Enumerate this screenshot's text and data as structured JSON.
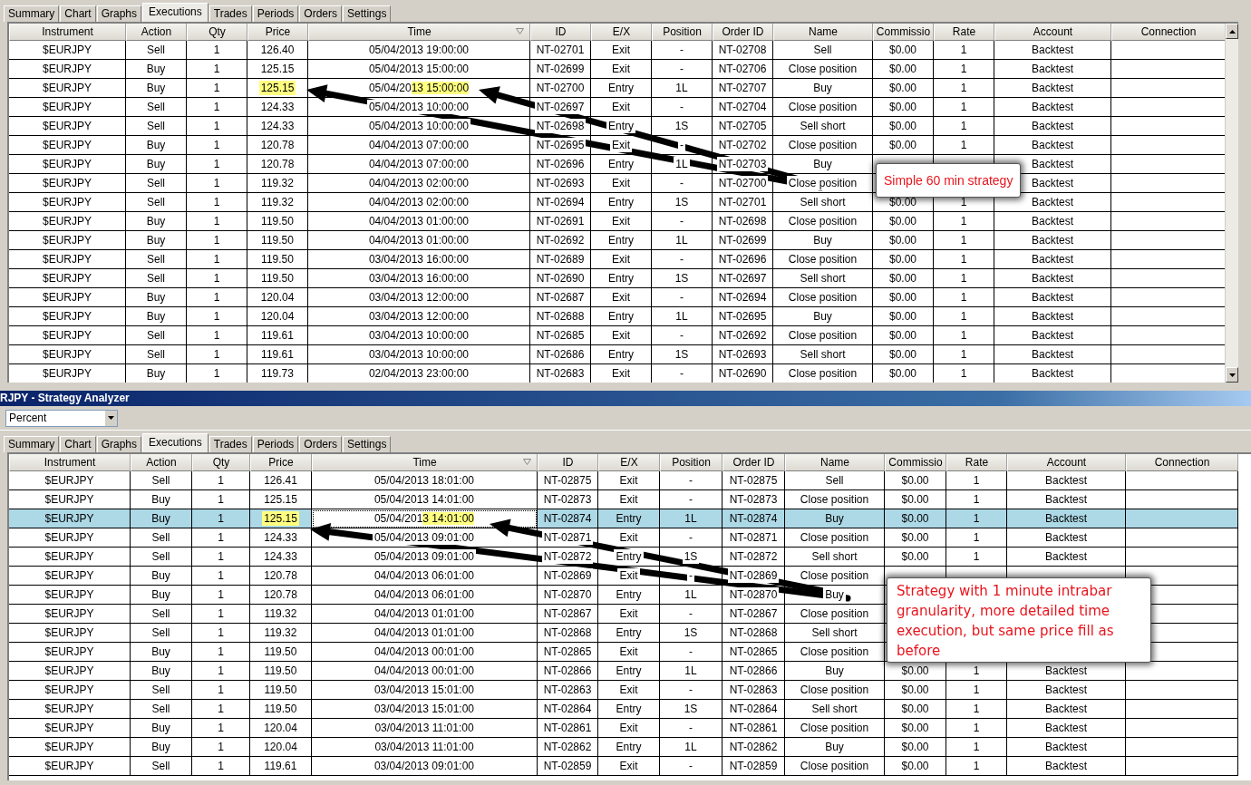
{
  "top_panel": {
    "tabs": [
      {
        "label": "Summary",
        "selected": false
      },
      {
        "label": "Chart",
        "selected": false
      },
      {
        "label": "Graphs",
        "selected": false
      },
      {
        "label": "Executions",
        "selected": true
      },
      {
        "label": "Trades",
        "selected": false
      },
      {
        "label": "Periods",
        "selected": false
      },
      {
        "label": "Orders",
        "selected": false
      },
      {
        "label": "Settings",
        "selected": false
      }
    ],
    "table": {
      "columns": [
        "Instrument",
        "Action",
        "Qty",
        "Price",
        "Time",
        "ID",
        "E/X",
        "Position",
        "Order ID",
        "Name",
        "Commissio",
        "Rate",
        "Account",
        "Connection"
      ],
      "rows": [
        {
          "instrument": "$EURJPY",
          "action": "Sell",
          "qty": "1",
          "price": "126.40",
          "time": "05/04/2013 19:00:00",
          "id": "NT-02701",
          "ex": "Exit",
          "position": "-",
          "order_id": "NT-02708",
          "name": "Sell",
          "commission": "$0.00",
          "rate": "1",
          "account": "Backtest",
          "highlighted": false
        },
        {
          "instrument": "$EURJPY",
          "action": "Buy",
          "qty": "1",
          "price": "125.15",
          "time": "05/04/2013 15:00:00",
          "id": "NT-02699",
          "ex": "Exit",
          "position": "-",
          "order_id": "NT-02706",
          "name": "Close position",
          "commission": "$0.00",
          "rate": "1",
          "account": "Backtest",
          "highlighted": false
        },
        {
          "instrument": "$EURJPY",
          "action": "Buy",
          "qty": "1",
          "price": "125.15",
          "time": "05/04/20",
          "time_marked": "13 15:00:00",
          "id": "NT-02700",
          "ex": "Entry",
          "position": "1L",
          "order_id": "NT-02707",
          "name": "Buy",
          "commission": "$0.00",
          "rate": "1",
          "account": "Backtest",
          "highlighted": true
        },
        {
          "instrument": "$EURJPY",
          "action": "Sell",
          "qty": "1",
          "price": "124.33",
          "time": "05/04/2013 10:00:00",
          "id": "NT-02697",
          "ex": "Exit",
          "position": "-",
          "order_id": "NT-02704",
          "name": "Close position",
          "commission": "$0.00",
          "rate": "1",
          "account": "Backtest",
          "highlighted": false
        },
        {
          "instrument": "$EURJPY",
          "action": "Sell",
          "qty": "1",
          "price": "124.33",
          "time": "05/04/2013 10:00:00",
          "id": "NT-02698",
          "ex": "Entry",
          "position": "1S",
          "order_id": "NT-02705",
          "name": "Sell short",
          "commission": "$0.00",
          "rate": "1",
          "account": "Backtest",
          "highlighted": false
        },
        {
          "instrument": "$EURJPY",
          "action": "Buy",
          "qty": "1",
          "price": "120.78",
          "time": "04/04/2013 07:00:00",
          "id": "NT-02695",
          "ex": "Exit",
          "position": "-",
          "order_id": "NT-02702",
          "name": "Close position",
          "commission": "$0.00",
          "rate": "1",
          "account": "Backtest",
          "highlighted": false
        },
        {
          "instrument": "$EURJPY",
          "action": "Buy",
          "qty": "1",
          "price": "120.78",
          "time": "04/04/2013 07:00:00",
          "id": "NT-02696",
          "ex": "Entry",
          "position": "1L",
          "order_id": "NT-02703",
          "name": "Buy",
          "account": "Backtest",
          "highlighted": false
        },
        {
          "instrument": "$EURJPY",
          "action": "Sell",
          "qty": "1",
          "price": "119.32",
          "time": "04/04/2013 02:00:00",
          "id": "NT-02693",
          "ex": "Exit",
          "position": "-",
          "order_id": "NT-02700",
          "name": "Close position",
          "account": "Backtest",
          "highlighted": false
        },
        {
          "instrument": "$EURJPY",
          "action": "Sell",
          "qty": "1",
          "price": "119.32",
          "time": "04/04/2013 02:00:00",
          "id": "NT-02694",
          "ex": "Entry",
          "position": "1S",
          "order_id": "NT-02701",
          "name": "Sell short",
          "commission": "$0.00",
          "rate": "1",
          "account": "Backtest",
          "highlighted": false
        },
        {
          "instrument": "$EURJPY",
          "action": "Buy",
          "qty": "1",
          "price": "119.50",
          "time": "04/04/2013 01:00:00",
          "id": "NT-02691",
          "ex": "Exit",
          "position": "-",
          "order_id": "NT-02698",
          "name": "Close position",
          "commission": "$0.00",
          "rate": "1",
          "account": "Backtest",
          "highlighted": false
        },
        {
          "instrument": "$EURJPY",
          "action": "Buy",
          "qty": "1",
          "price": "119.50",
          "time": "04/04/2013 01:00:00",
          "id": "NT-02692",
          "ex": "Entry",
          "position": "1L",
          "order_id": "NT-02699",
          "name": "Buy",
          "commission": "$0.00",
          "rate": "1",
          "account": "Backtest",
          "highlighted": false
        },
        {
          "instrument": "$EURJPY",
          "action": "Sell",
          "qty": "1",
          "price": "119.50",
          "time": "03/04/2013 16:00:00",
          "id": "NT-02689",
          "ex": "Exit",
          "position": "-",
          "order_id": "NT-02696",
          "name": "Close position",
          "commission": "$0.00",
          "rate": "1",
          "account": "Backtest",
          "highlighted": false
        },
        {
          "instrument": "$EURJPY",
          "action": "Sell",
          "qty": "1",
          "price": "119.50",
          "time": "03/04/2013 16:00:00",
          "id": "NT-02690",
          "ex": "Entry",
          "position": "1S",
          "order_id": "NT-02697",
          "name": "Sell short",
          "commission": "$0.00",
          "rate": "1",
          "account": "Backtest",
          "highlighted": false
        },
        {
          "instrument": "$EURJPY",
          "action": "Buy",
          "qty": "1",
          "price": "120.04",
          "time": "03/04/2013 12:00:00",
          "id": "NT-02687",
          "ex": "Exit",
          "position": "-",
          "order_id": "NT-02694",
          "name": "Close position",
          "commission": "$0.00",
          "rate": "1",
          "account": "Backtest",
          "highlighted": false
        },
        {
          "instrument": "$EURJPY",
          "action": "Buy",
          "qty": "1",
          "price": "120.04",
          "time": "03/04/2013 12:00:00",
          "id": "NT-02688",
          "ex": "Entry",
          "position": "1L",
          "order_id": "NT-02695",
          "name": "Buy",
          "commission": "$0.00",
          "rate": "1",
          "account": "Backtest",
          "highlighted": false
        },
        {
          "instrument": "$EURJPY",
          "action": "Sell",
          "qty": "1",
          "price": "119.61",
          "time": "03/04/2013 10:00:00",
          "id": "NT-02685",
          "ex": "Exit",
          "position": "-",
          "order_id": "NT-02692",
          "name": "Close position",
          "commission": "$0.00",
          "rate": "1",
          "account": "Backtest",
          "highlighted": false
        },
        {
          "instrument": "$EURJPY",
          "action": "Sell",
          "qty": "1",
          "price": "119.61",
          "time": "03/04/2013 10:00:00",
          "id": "NT-02686",
          "ex": "Entry",
          "position": "1S",
          "order_id": "NT-02693",
          "name": "Sell short",
          "commission": "$0.00",
          "rate": "1",
          "account": "Backtest",
          "highlighted": false
        },
        {
          "instrument": "$EURJPY",
          "action": "Buy",
          "qty": "1",
          "price": "119.73",
          "time": "02/04/2013 23:00:00",
          "id": "NT-02683",
          "ex": "Exit",
          "position": "-",
          "order_id": "NT-02690",
          "name": "Close position",
          "commission": "$0.00",
          "rate": "1",
          "account": "Backtest",
          "highlighted": false
        }
      ]
    },
    "callout": "Simple 60 min strategy"
  },
  "window": {
    "title": "RJPY - Strategy Analyzer"
  },
  "toolbar": {
    "dropdown": {
      "value": "Percent"
    }
  },
  "bottom_panel": {
    "tabs": [
      {
        "label": "Summary",
        "selected": false
      },
      {
        "label": "Chart",
        "selected": false
      },
      {
        "label": "Graphs",
        "selected": false
      },
      {
        "label": "Executions",
        "selected": true
      },
      {
        "label": "Trades",
        "selected": false
      },
      {
        "label": "Periods",
        "selected": false
      },
      {
        "label": "Orders",
        "selected": false
      },
      {
        "label": "Settings",
        "selected": false
      }
    ],
    "table": {
      "columns": [
        "Instrument",
        "Action",
        "Qty",
        "Price",
        "Time",
        "ID",
        "E/X",
        "Position",
        "Order ID",
        "Name",
        "Commissio",
        "Rate",
        "Account",
        "Connection"
      ],
      "rows": [
        {
          "instrument": "$EURJPY",
          "action": "Sell",
          "qty": "1",
          "price": "126.41",
          "time": "05/04/2013 18:01:00",
          "id": "NT-02875",
          "ex": "Exit",
          "position": "-",
          "order_id": "NT-02875",
          "name": "Sell",
          "commission": "$0.00",
          "rate": "1",
          "account": "Backtest",
          "highlighted": false,
          "selected": false
        },
        {
          "instrument": "$EURJPY",
          "action": "Buy",
          "qty": "1",
          "price": "125.15",
          "time": "05/04/2013 14:01:00",
          "id": "NT-02873",
          "ex": "Exit",
          "position": "-",
          "order_id": "NT-02873",
          "name": "Close position",
          "commission": "$0.00",
          "rate": "1",
          "account": "Backtest",
          "highlighted": false,
          "selected": false
        },
        {
          "instrument": "$EURJPY",
          "action": "Buy",
          "qty": "1",
          "price": "125.15",
          "time": "05/04/201",
          "time_marked": "3 14:01:00",
          "id": "NT-02874",
          "ex": "Entry",
          "position": "1L",
          "order_id": "NT-02874",
          "name": "Buy",
          "commission": "$0.00",
          "rate": "1",
          "account": "Backtest",
          "highlighted": true,
          "selected": true
        },
        {
          "instrument": "$EURJPY",
          "action": "Sell",
          "qty": "1",
          "price": "124.33",
          "time": "05/04/2013 09:01:00",
          "id": "NT-02871",
          "ex": "Exit",
          "position": "-",
          "order_id": "NT-02871",
          "name": "Close position",
          "commission": "$0.00",
          "rate": "1",
          "account": "Backtest",
          "highlighted": false,
          "selected": false
        },
        {
          "instrument": "$EURJPY",
          "action": "Sell",
          "qty": "1",
          "price": "124.33",
          "time": "05/04/2013 09:01:00",
          "id": "NT-02872",
          "ex": "Entry",
          "position": "1S",
          "order_id": "NT-02872",
          "name": "Sell short",
          "commission": "$0.00",
          "rate": "1",
          "account": "Backtest",
          "highlighted": false,
          "selected": false
        },
        {
          "instrument": "$EURJPY",
          "action": "Buy",
          "qty": "1",
          "price": "120.78",
          "time": "04/04/2013 06:01:00",
          "id": "NT-02869",
          "ex": "Exit",
          "position": "-",
          "order_id": "NT-02869",
          "name": "Close position",
          "highlighted": false,
          "selected": false
        },
        {
          "instrument": "$EURJPY",
          "action": "Buy",
          "qty": "1",
          "price": "120.78",
          "time": "04/04/2013 06:01:00",
          "id": "NT-02870",
          "ex": "Entry",
          "position": "1L",
          "order_id": "NT-02870",
          "name": "Buy",
          "highlighted": false,
          "selected": false
        },
        {
          "instrument": "$EURJPY",
          "action": "Sell",
          "qty": "1",
          "price": "119.32",
          "time": "04/04/2013 01:01:00",
          "id": "NT-02867",
          "ex": "Exit",
          "position": "-",
          "order_id": "NT-02867",
          "name": "Close position",
          "highlighted": false,
          "selected": false
        },
        {
          "instrument": "$EURJPY",
          "action": "Sell",
          "qty": "1",
          "price": "119.32",
          "time": "04/04/2013 01:01:00",
          "id": "NT-02868",
          "ex": "Entry",
          "position": "1S",
          "order_id": "NT-02868",
          "name": "Sell short",
          "highlighted": false,
          "selected": false
        },
        {
          "instrument": "$EURJPY",
          "action": "Buy",
          "qty": "1",
          "price": "119.50",
          "time": "04/04/2013 00:01:00",
          "id": "NT-02865",
          "ex": "Exit",
          "position": "-",
          "order_id": "NT-02865",
          "name": "Close position",
          "highlighted": false,
          "selected": false
        },
        {
          "instrument": "$EURJPY",
          "action": "Buy",
          "qty": "1",
          "price": "119.50",
          "time": "04/04/2013 00:01:00",
          "id": "NT-02866",
          "ex": "Entry",
          "position": "1L",
          "order_id": "NT-02866",
          "name": "Buy",
          "commission": "$0.00",
          "rate": "1",
          "account": "Backtest",
          "highlighted": false,
          "selected": false
        },
        {
          "instrument": "$EURJPY",
          "action": "Sell",
          "qty": "1",
          "price": "119.50",
          "time": "03/04/2013 15:01:00",
          "id": "NT-02863",
          "ex": "Exit",
          "position": "-",
          "order_id": "NT-02863",
          "name": "Close position",
          "commission": "$0.00",
          "rate": "1",
          "account": "Backtest",
          "highlighted": false,
          "selected": false
        },
        {
          "instrument": "$EURJPY",
          "action": "Sell",
          "qty": "1",
          "price": "119.50",
          "time": "03/04/2013 15:01:00",
          "id": "NT-02864",
          "ex": "Entry",
          "position": "1S",
          "order_id": "NT-02864",
          "name": "Sell short",
          "commission": "$0.00",
          "rate": "1",
          "account": "Backtest",
          "highlighted": false,
          "selected": false
        },
        {
          "instrument": "$EURJPY",
          "action": "Buy",
          "qty": "1",
          "price": "120.04",
          "time": "03/04/2013 11:01:00",
          "id": "NT-02861",
          "ex": "Exit",
          "position": "-",
          "order_id": "NT-02861",
          "name": "Close position",
          "commission": "$0.00",
          "rate": "1",
          "account": "Backtest",
          "highlighted": false,
          "selected": false
        },
        {
          "instrument": "$EURJPY",
          "action": "Buy",
          "qty": "1",
          "price": "120.04",
          "time": "03/04/2013 11:01:00",
          "id": "NT-02862",
          "ex": "Entry",
          "position": "1L",
          "order_id": "NT-02862",
          "name": "Buy",
          "commission": "$0.00",
          "rate": "1",
          "account": "Backtest",
          "highlighted": false,
          "selected": false
        },
        {
          "instrument": "$EURJPY",
          "action": "Sell",
          "qty": "1",
          "price": "119.61",
          "time": "03/04/2013 09:01:00",
          "id": "NT-02859",
          "ex": "Exit",
          "position": "-",
          "order_id": "NT-02859",
          "name": "Close position",
          "commission": "$0.00",
          "rate": "1",
          "account": "Backtest",
          "highlighted": false,
          "selected": false
        }
      ]
    },
    "callout": "Strategy with 1 minute intrabar granularity, more detailed time execution, but same price fill as before"
  }
}
